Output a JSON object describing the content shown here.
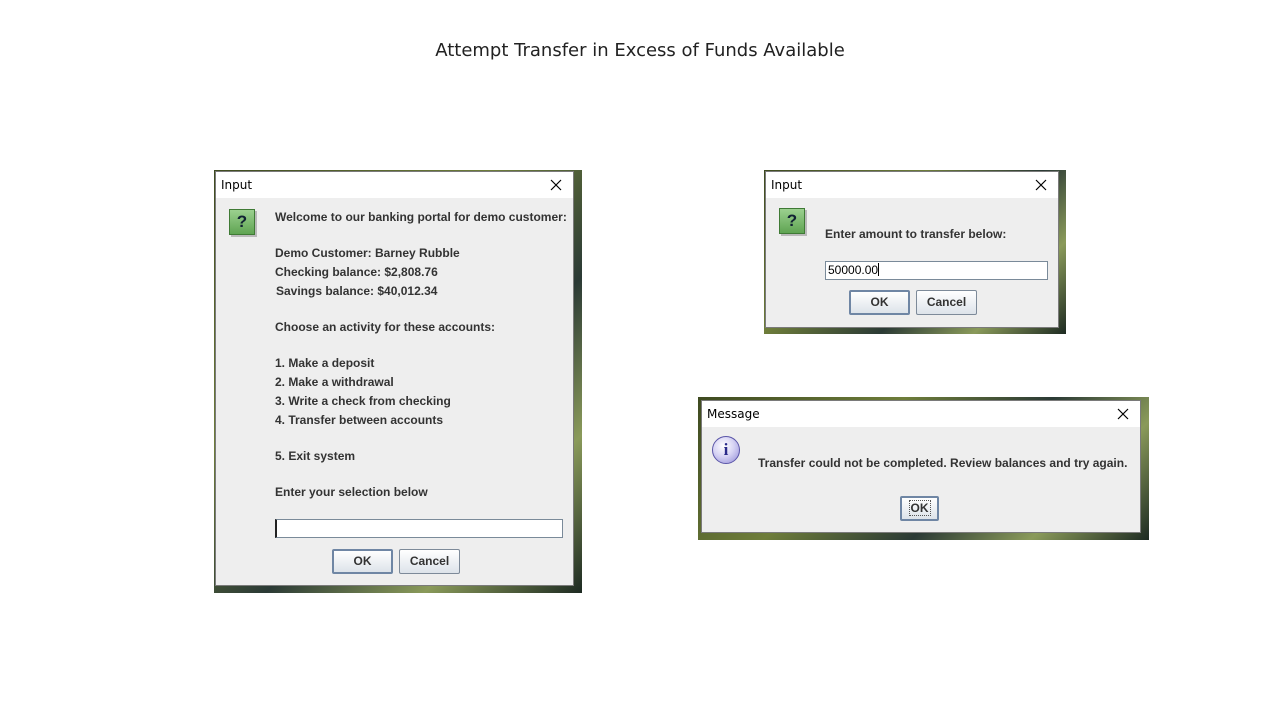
{
  "slide": {
    "title": "Attempt Transfer  in Excess of Funds Available"
  },
  "dialog_menu": {
    "title": "Input",
    "lines": {
      "welcome": "Welcome to our banking portal for demo customer:",
      "customer": "Demo Customer:  Barney Rubble",
      "checking": "Checking balance: $2,808.76",
      "savings": "Savings balance:  $40,012.34",
      "choose": "Choose an activity for these accounts:",
      "opt1": "1.  Make a deposit",
      "opt2": "2.  Make a withdrawal",
      "opt3": "3.  Write a check from checking",
      "opt4": "4.  Transfer between accounts",
      "opt5": "5.  Exit system",
      "prompt": "Enter your selection below"
    },
    "input_value": "",
    "ok_label": "OK",
    "cancel_label": "Cancel"
  },
  "dialog_amount": {
    "title": "Input",
    "prompt": "Enter amount to transfer below:",
    "input_value": "50000.00",
    "ok_label": "OK",
    "cancel_label": "Cancel"
  },
  "dialog_message": {
    "title": "Message",
    "text": "Transfer could not be completed.  Review balances and try again.",
    "ok_label": "OK"
  },
  "icons": {
    "question": "question-icon",
    "info": "information-icon",
    "close": "close-icon"
  },
  "colors": {
    "window_bg": "#eeeeee",
    "question_icon": "#6cb15f",
    "info_icon": "#8f89d6"
  }
}
